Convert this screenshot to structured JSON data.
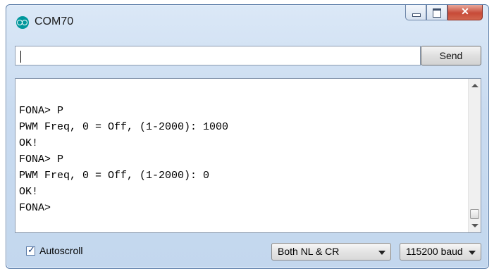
{
  "window": {
    "title": "COM70",
    "icon": "arduino-logo-icon",
    "caption_buttons": {
      "minimize": "minimize-icon",
      "maximize": "maximize-icon",
      "close": "✕"
    }
  },
  "input": {
    "value": "",
    "send_label": "Send"
  },
  "output": {
    "lines": [
      "FONA> P",
      "PWM Freq, 0 = Off, (1-2000): 1000",
      "OK!",
      "FONA> P",
      "PWM Freq, 0 = Off, (1-2000): 0",
      "OK!",
      "FONA>"
    ]
  },
  "footer": {
    "autoscroll_label": "Autoscroll",
    "autoscroll_checked": true,
    "line_ending": "Both NL & CR",
    "baud_rate": "115200 baud"
  },
  "colors": {
    "accent": "#00979c",
    "close_button": "#c74a38"
  }
}
